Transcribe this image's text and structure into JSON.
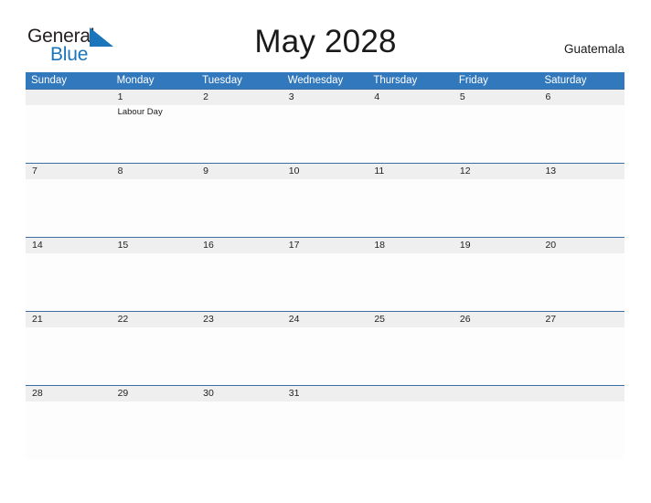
{
  "brand": {
    "name_part1": "General",
    "name_part2": "Blue",
    "flag_icon": "blue-flag-triangle-icon",
    "color_dark": "#231f20",
    "color_blue": "#1b75bb"
  },
  "header": {
    "title": "May 2028",
    "country": "Guatemala"
  },
  "theme": {
    "header_blue": "#3278bd",
    "week_band_gray": "#efefef",
    "week_rule": "#3a6ea5",
    "cell_bg": "#fdfdfd",
    "text": "#222222"
  },
  "calendar": {
    "day_headers": [
      "Sunday",
      "Monday",
      "Tuesday",
      "Wednesday",
      "Thursday",
      "Friday",
      "Saturday"
    ],
    "weeks": [
      {
        "days": [
          {
            "num": "",
            "events": []
          },
          {
            "num": "1",
            "events": [
              "Labour Day"
            ]
          },
          {
            "num": "2",
            "events": []
          },
          {
            "num": "3",
            "events": []
          },
          {
            "num": "4",
            "events": []
          },
          {
            "num": "5",
            "events": []
          },
          {
            "num": "6",
            "events": []
          }
        ]
      },
      {
        "days": [
          {
            "num": "7",
            "events": []
          },
          {
            "num": "8",
            "events": []
          },
          {
            "num": "9",
            "events": []
          },
          {
            "num": "10",
            "events": []
          },
          {
            "num": "11",
            "events": []
          },
          {
            "num": "12",
            "events": []
          },
          {
            "num": "13",
            "events": []
          }
        ]
      },
      {
        "days": [
          {
            "num": "14",
            "events": []
          },
          {
            "num": "15",
            "events": []
          },
          {
            "num": "16",
            "events": []
          },
          {
            "num": "17",
            "events": []
          },
          {
            "num": "18",
            "events": []
          },
          {
            "num": "19",
            "events": []
          },
          {
            "num": "20",
            "events": []
          }
        ]
      },
      {
        "days": [
          {
            "num": "21",
            "events": []
          },
          {
            "num": "22",
            "events": []
          },
          {
            "num": "23",
            "events": []
          },
          {
            "num": "24",
            "events": []
          },
          {
            "num": "25",
            "events": []
          },
          {
            "num": "26",
            "events": []
          },
          {
            "num": "27",
            "events": []
          }
        ]
      },
      {
        "days": [
          {
            "num": "28",
            "events": []
          },
          {
            "num": "29",
            "events": []
          },
          {
            "num": "30",
            "events": []
          },
          {
            "num": "31",
            "events": []
          },
          {
            "num": "",
            "events": []
          },
          {
            "num": "",
            "events": []
          },
          {
            "num": "",
            "events": []
          }
        ]
      }
    ]
  }
}
